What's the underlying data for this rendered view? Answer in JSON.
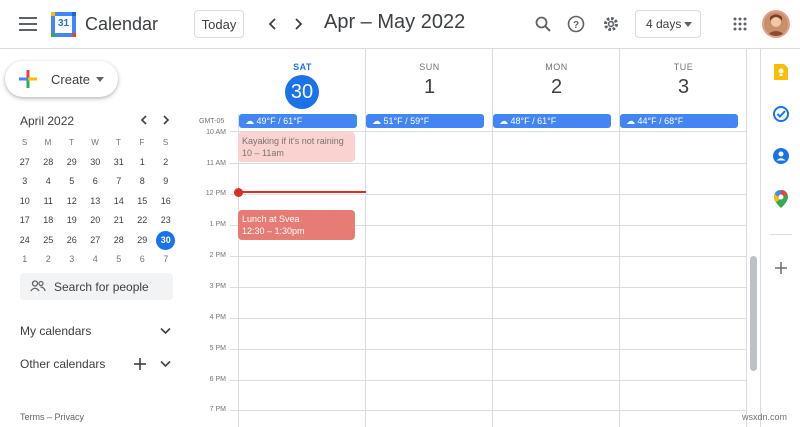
{
  "header": {
    "app_title": "Calendar",
    "logo_day": "31",
    "today_label": "Today",
    "date_range": "Apr – May 2022",
    "view_label": "4 days"
  },
  "sidebar": {
    "create_label": "Create",
    "mini_calendar": {
      "title": "April 2022",
      "weekdays": [
        "S",
        "M",
        "T",
        "W",
        "T",
        "F",
        "S"
      ],
      "weeks": [
        [
          "27",
          "28",
          "29",
          "30",
          "31",
          "1",
          "2"
        ],
        [
          "3",
          "4",
          "5",
          "6",
          "7",
          "8",
          "9"
        ],
        [
          "10",
          "11",
          "12",
          "13",
          "14",
          "15",
          "16"
        ],
        [
          "17",
          "18",
          "19",
          "20",
          "21",
          "22",
          "23"
        ],
        [
          "24",
          "25",
          "26",
          "27",
          "28",
          "29",
          "30"
        ],
        [
          "1",
          "2",
          "3",
          "4",
          "5",
          "6",
          "7"
        ]
      ]
    },
    "search_people_placeholder": "Search for people",
    "my_calendars": "My calendars",
    "other_calendars": "Other calendars",
    "footer": "Terms – Privacy"
  },
  "grid": {
    "timezone": "GMT-05",
    "days": [
      {
        "dow": "SAT",
        "num": "30",
        "weather": "49°F / 61°F",
        "today": true
      },
      {
        "dow": "SUN",
        "num": "1",
        "weather": "51°F / 59°F"
      },
      {
        "dow": "MON",
        "num": "2",
        "weather": "48°F / 61°F"
      },
      {
        "dow": "TUE",
        "num": "3",
        "weather": "44°F / 68°F"
      }
    ],
    "hours": [
      "10 AM",
      "11 AM",
      "12 PM",
      "1 PM",
      "2 PM",
      "3 PM",
      "4 PM",
      "5 PM",
      "6 PM",
      "7 PM"
    ],
    "events": [
      {
        "title": "Kayaking if it's not raining",
        "time": "10 – 11am",
        "color": "#fad2cf"
      },
      {
        "title": "Lunch at Svea",
        "time": "12:30 – 1:30pm",
        "color": "#e67c73"
      }
    ]
  },
  "watermark": "wsxdn.com",
  "colors": {
    "accent": "#1a73e8",
    "now_line": "#d93025"
  }
}
